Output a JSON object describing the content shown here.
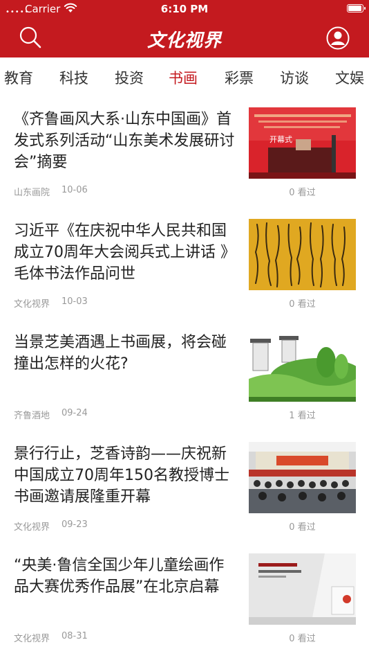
{
  "status_bar": {
    "carrier": "Carrier",
    "time": "6:10 PM",
    "signal": "•••••",
    "battery_level": 1.0
  },
  "header": {
    "title": "文化视界",
    "search_icon": "search-icon",
    "user_icon": "user-icon",
    "brand_color": "#c41a1f"
  },
  "tabs": {
    "items": [
      {
        "label": "教育"
      },
      {
        "label": "科技"
      },
      {
        "label": "投资"
      },
      {
        "label": "书画"
      },
      {
        "label": "彩票"
      },
      {
        "label": "访谈"
      },
      {
        "label": "文娱"
      }
    ],
    "active_index": 3
  },
  "articles": [
    {
      "title": "《齐鲁画风大系·山东中国画》首发式系列活动“山东美术发展研讨会”摘要",
      "source": "山东画院",
      "date": "10-06",
      "views": "0 看过",
      "thumb_caption": "开幕式"
    },
    {
      "title": "习近平《在庆祝中华人民共和国成立70周年大会阅兵式上讲话 》毛体书法作品问世",
      "source": "文化视界",
      "date": "10-03",
      "views": "0 看过"
    },
    {
      "title": "当景芝美酒遇上书画展，将会碰撞出怎样的火花?",
      "source": "齐鲁酒地",
      "date": "09-24",
      "views": "1 看过"
    },
    {
      "title": "景行行止，芝香诗韵——庆祝新中国成立70周年150名教授博士书画邀请展隆重开幕",
      "source": "文化视界",
      "date": "09-23",
      "views": "0 看过"
    },
    {
      "title": "“央美·鲁信全国少年儿童绘画作品大赛优秀作品展”在北京启幕",
      "source": "文化视界",
      "date": "08-31",
      "views": "0 看过"
    }
  ]
}
